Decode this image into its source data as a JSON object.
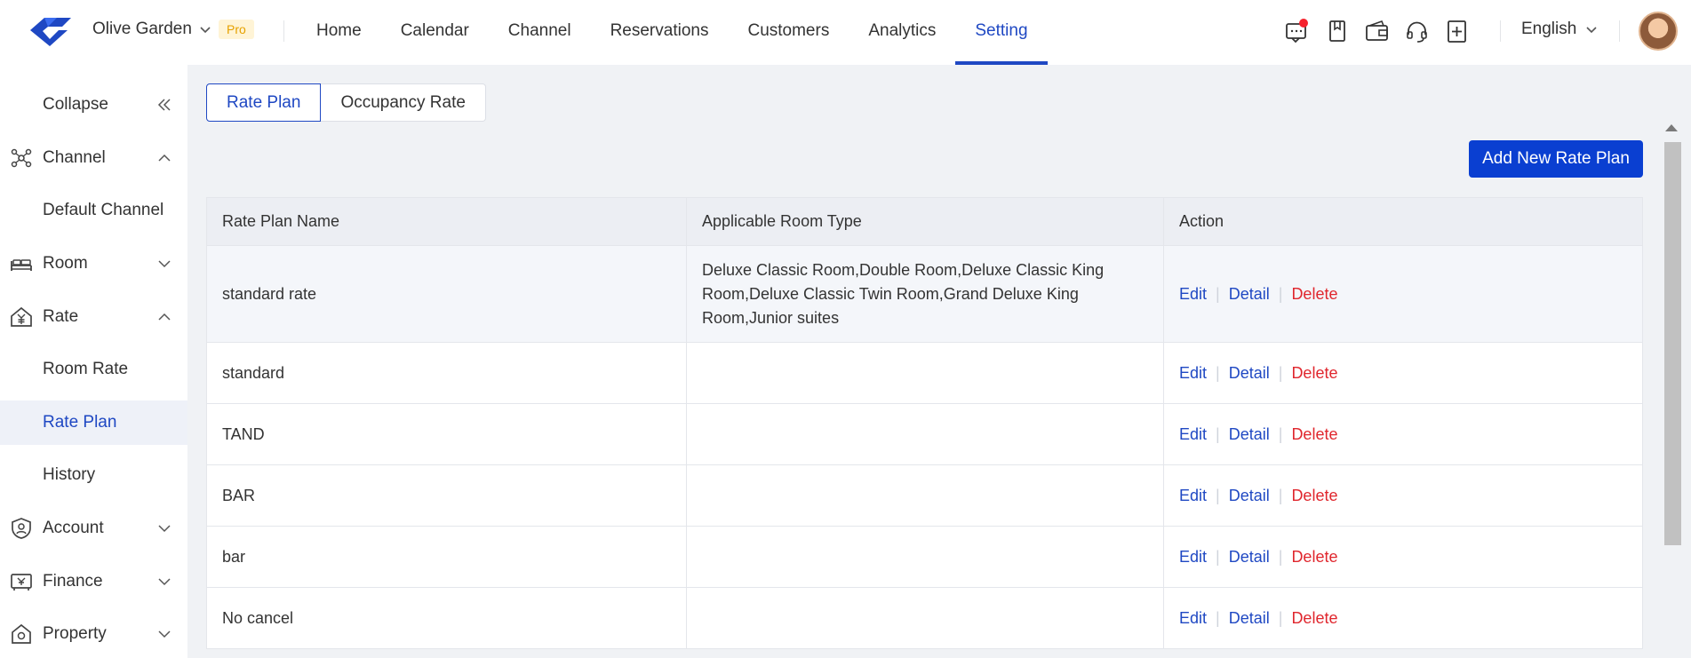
{
  "header": {
    "hotel_name": "Olive Garden",
    "badge": "Pro",
    "nav": [
      {
        "label": "Home"
      },
      {
        "label": "Calendar"
      },
      {
        "label": "Channel"
      },
      {
        "label": "Reservations"
      },
      {
        "label": "Customers"
      },
      {
        "label": "Analytics"
      },
      {
        "label": "Setting"
      }
    ],
    "active_nav": "Setting",
    "language": "English",
    "tools": [
      "message-icon",
      "book-icon",
      "wallet-icon",
      "headset-icon",
      "add-document-icon"
    ]
  },
  "sidebar": {
    "collapse": "Collapse",
    "items": [
      {
        "label": "Channel",
        "icon": "channel-icon",
        "expanded": true
      },
      {
        "label": "Default Channel"
      },
      {
        "label": "Room",
        "icon": "bed-icon",
        "expanded": false
      },
      {
        "label": "Rate",
        "icon": "rate-icon",
        "expanded": true
      },
      {
        "label": "Room Rate"
      },
      {
        "label": "Rate Plan",
        "active": true
      },
      {
        "label": "History"
      },
      {
        "label": "Account",
        "icon": "account-icon",
        "expanded": false
      },
      {
        "label": "Finance",
        "icon": "finance-icon",
        "expanded": false
      },
      {
        "label": "Property",
        "icon": "property-icon",
        "expanded": false
      }
    ]
  },
  "main": {
    "tabs": [
      {
        "label": "Rate Plan",
        "active": true
      },
      {
        "label": "Occupancy Rate"
      }
    ],
    "add_button": "Add New Rate Plan",
    "table": {
      "headers": [
        "Rate Plan Name",
        "Applicable Room Type",
        "Action"
      ],
      "actions": [
        "Edit",
        "Detail",
        "Delete"
      ],
      "rows": [
        {
          "name": "standard rate",
          "room_types": "Deluxe Classic Room,Double Room,Deluxe Classic King Room,Deluxe Classic Twin Room,Grand Deluxe King Room,Junior suites"
        },
        {
          "name": "standard",
          "room_types": ""
        },
        {
          "name": "TAND",
          "room_types": ""
        },
        {
          "name": "BAR",
          "room_types": ""
        },
        {
          "name": "bar",
          "room_types": ""
        },
        {
          "name": "No cancel",
          "room_types": ""
        }
      ]
    }
  },
  "colors": {
    "accent": "#1f48c3",
    "button": "#0a3fd1",
    "danger": "#e0262d",
    "badge_bg": "#fff4d6"
  }
}
